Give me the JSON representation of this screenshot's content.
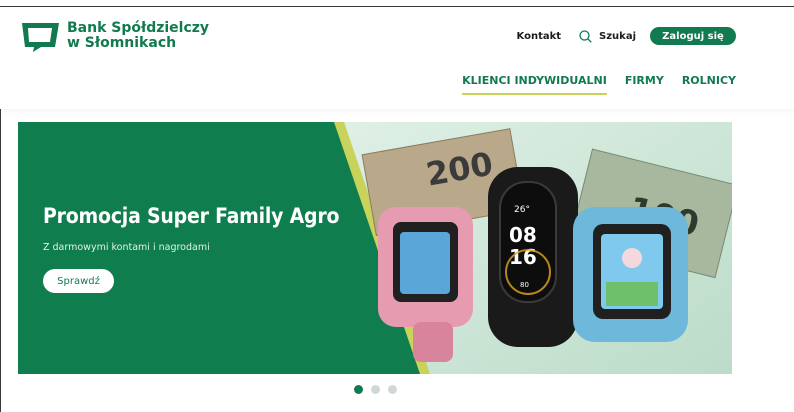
{
  "brand": {
    "line1": "Bank Spółdzielczy",
    "line2": "w Słomnikach",
    "color": "#127a4f"
  },
  "top_actions": {
    "contact_label": "Kontakt",
    "search_label": "Szukaj",
    "login_label": "Zaloguj się"
  },
  "nav": {
    "items": [
      {
        "label": "KLIENCI INDYWIDUALNI",
        "active": true
      },
      {
        "label": "FIRMY",
        "active": false
      },
      {
        "label": "ROLNICY",
        "active": false
      }
    ],
    "active_underline_color": "#c9d25a"
  },
  "banner": {
    "title": "Promocja Super Family Agro",
    "subtitle": "Z darmowymi kontami i nagrodami",
    "button_label": "Sprawdź",
    "image_text": {
      "note_200": "200",
      "note_100": "100",
      "band_time_top": "08",
      "band_time_bottom": "16",
      "band_temp": "26°",
      "band_heart": "80"
    }
  },
  "carousel": {
    "slides": 3,
    "active_index": 0
  }
}
